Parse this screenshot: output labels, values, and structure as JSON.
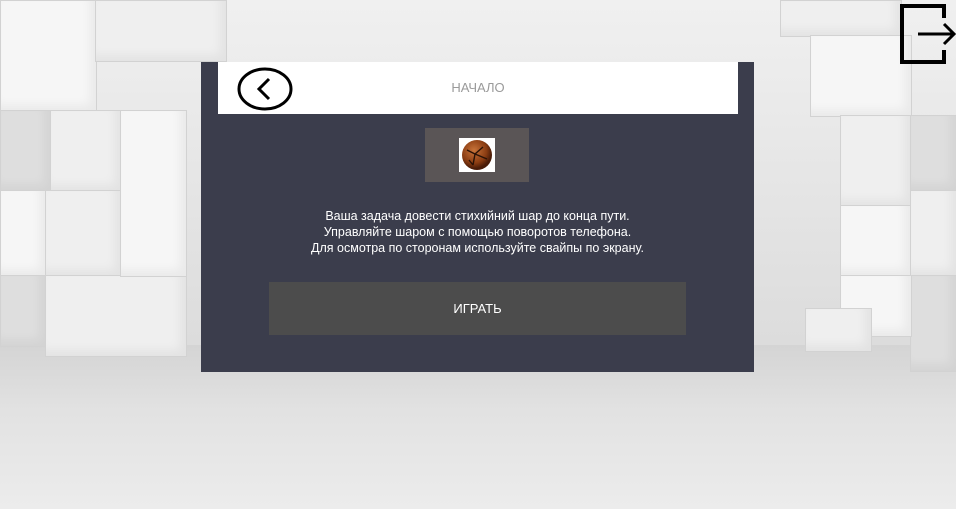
{
  "header": {
    "title": "НАЧАЛО",
    "back_icon": "chevron-left-circle-icon"
  },
  "exit_icon": "exit-door-icon",
  "selected_ball": {
    "icon": "elemental-ball-icon",
    "colors": {
      "base": "#8a3c12",
      "highlight": "#c9743a",
      "cracks": "#2a1206"
    }
  },
  "description": {
    "line1": "Ваша задача довести стихийний шар до конца пути.",
    "line2": "Управляйте шаром с помощью поворотов телефона.",
    "line3": "Для осмотра по сторонам используйте свайпы по экрану."
  },
  "play_button": {
    "label": "ИГРАТЬ"
  },
  "colors": {
    "panel": "#3b3d4c",
    "header": "#ffffff",
    "title_text": "#9a9a9a",
    "play_button": "#4c4c4c",
    "ball_box": "#5a5556"
  }
}
